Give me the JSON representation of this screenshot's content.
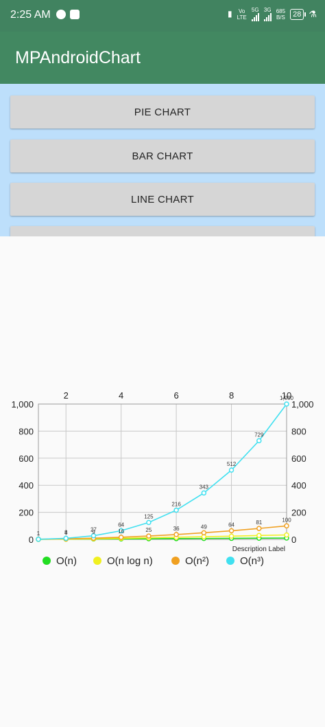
{
  "status_bar": {
    "time": "2:25 AM",
    "left_icons": [
      "sync-icon",
      "badge-icon"
    ],
    "volte_top": "Vo",
    "volte_bottom": "LTE",
    "net1": "5G",
    "net2": "3G",
    "speed_value": "685",
    "speed_unit": "B/S",
    "battery": "28"
  },
  "app_bar": {
    "title": "MPAndroidChart"
  },
  "buttons": {
    "pie": "PIE CHART",
    "bar": "BAR CHART",
    "line": "LINE CHART"
  },
  "chart_data": {
    "type": "line",
    "x": [
      1,
      2,
      3,
      4,
      5,
      6,
      7,
      8,
      9,
      10
    ],
    "x_top_ticks": [
      2,
      4,
      6,
      8,
      10
    ],
    "y_ticks": [
      "0",
      "200",
      "400",
      "600",
      "800",
      "1,000"
    ],
    "ylim": [
      0,
      1000
    ],
    "xlim": [
      1,
      10
    ],
    "grid": true,
    "legend_position": "bottom-left",
    "description": "Description Label",
    "series": [
      {
        "name": "O(n)",
        "color": "#22dd22",
        "values": [
          1,
          2,
          3,
          4,
          5,
          6,
          7,
          8,
          9,
          10
        ]
      },
      {
        "name": "O(n log n)",
        "color": "#f0f020",
        "values": [
          0,
          2,
          5,
          8,
          12,
          16,
          20,
          24,
          29,
          33
        ]
      },
      {
        "name": "O(n²)",
        "color": "#f0a020",
        "values": [
          1,
          4,
          9,
          16,
          25,
          36,
          49,
          64,
          81,
          100
        ]
      },
      {
        "name": "O(n³)",
        "color": "#40e0f0",
        "values": [
          1,
          8,
          27,
          64,
          125,
          216,
          343,
          512,
          729,
          1000
        ]
      }
    ],
    "point_labels": [
      "1",
      "8",
      "27",
      "64",
      "125",
      "216",
      "343",
      "512",
      "729",
      "1,000"
    ],
    "sq_labels": [
      "1",
      "4",
      "9",
      "16",
      "25",
      "36",
      "49",
      "64",
      "81",
      "100"
    ]
  }
}
